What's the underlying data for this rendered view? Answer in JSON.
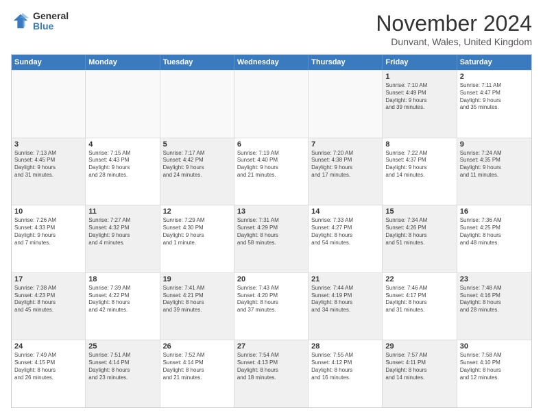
{
  "logo": {
    "general": "General",
    "blue": "Blue"
  },
  "title": "November 2024",
  "location": "Dunvant, Wales, United Kingdom",
  "headers": [
    "Sunday",
    "Monday",
    "Tuesday",
    "Wednesday",
    "Thursday",
    "Friday",
    "Saturday"
  ],
  "rows": [
    [
      {
        "day": "",
        "text": "",
        "empty": true
      },
      {
        "day": "",
        "text": "",
        "empty": true
      },
      {
        "day": "",
        "text": "",
        "empty": true
      },
      {
        "day": "",
        "text": "",
        "empty": true
      },
      {
        "day": "",
        "text": "",
        "empty": true
      },
      {
        "day": "1",
        "text": "Sunrise: 7:10 AM\nSunset: 4:49 PM\nDaylight: 9 hours\nand 39 minutes.",
        "shaded": true
      },
      {
        "day": "2",
        "text": "Sunrise: 7:11 AM\nSunset: 4:47 PM\nDaylight: 9 hours\nand 35 minutes.",
        "shaded": false
      }
    ],
    [
      {
        "day": "3",
        "text": "Sunrise: 7:13 AM\nSunset: 4:45 PM\nDaylight: 9 hours\nand 31 minutes.",
        "shaded": true
      },
      {
        "day": "4",
        "text": "Sunrise: 7:15 AM\nSunset: 4:43 PM\nDaylight: 9 hours\nand 28 minutes.",
        "shaded": false
      },
      {
        "day": "5",
        "text": "Sunrise: 7:17 AM\nSunset: 4:42 PM\nDaylight: 9 hours\nand 24 minutes.",
        "shaded": true
      },
      {
        "day": "6",
        "text": "Sunrise: 7:19 AM\nSunset: 4:40 PM\nDaylight: 9 hours\nand 21 minutes.",
        "shaded": false
      },
      {
        "day": "7",
        "text": "Sunrise: 7:20 AM\nSunset: 4:38 PM\nDaylight: 9 hours\nand 17 minutes.",
        "shaded": true
      },
      {
        "day": "8",
        "text": "Sunrise: 7:22 AM\nSunset: 4:37 PM\nDaylight: 9 hours\nand 14 minutes.",
        "shaded": false
      },
      {
        "day": "9",
        "text": "Sunrise: 7:24 AM\nSunset: 4:35 PM\nDaylight: 9 hours\nand 11 minutes.",
        "shaded": true
      }
    ],
    [
      {
        "day": "10",
        "text": "Sunrise: 7:26 AM\nSunset: 4:33 PM\nDaylight: 9 hours\nand 7 minutes.",
        "shaded": false
      },
      {
        "day": "11",
        "text": "Sunrise: 7:27 AM\nSunset: 4:32 PM\nDaylight: 9 hours\nand 4 minutes.",
        "shaded": true
      },
      {
        "day": "12",
        "text": "Sunrise: 7:29 AM\nSunset: 4:30 PM\nDaylight: 9 hours\nand 1 minute.",
        "shaded": false
      },
      {
        "day": "13",
        "text": "Sunrise: 7:31 AM\nSunset: 4:29 PM\nDaylight: 8 hours\nand 58 minutes.",
        "shaded": true
      },
      {
        "day": "14",
        "text": "Sunrise: 7:33 AM\nSunset: 4:27 PM\nDaylight: 8 hours\nand 54 minutes.",
        "shaded": false
      },
      {
        "day": "15",
        "text": "Sunrise: 7:34 AM\nSunset: 4:26 PM\nDaylight: 8 hours\nand 51 minutes.",
        "shaded": true
      },
      {
        "day": "16",
        "text": "Sunrise: 7:36 AM\nSunset: 4:25 PM\nDaylight: 8 hours\nand 48 minutes.",
        "shaded": false
      }
    ],
    [
      {
        "day": "17",
        "text": "Sunrise: 7:38 AM\nSunset: 4:23 PM\nDaylight: 8 hours\nand 45 minutes.",
        "shaded": true
      },
      {
        "day": "18",
        "text": "Sunrise: 7:39 AM\nSunset: 4:22 PM\nDaylight: 8 hours\nand 42 minutes.",
        "shaded": false
      },
      {
        "day": "19",
        "text": "Sunrise: 7:41 AM\nSunset: 4:21 PM\nDaylight: 8 hours\nand 39 minutes.",
        "shaded": true
      },
      {
        "day": "20",
        "text": "Sunrise: 7:43 AM\nSunset: 4:20 PM\nDaylight: 8 hours\nand 37 minutes.",
        "shaded": false
      },
      {
        "day": "21",
        "text": "Sunrise: 7:44 AM\nSunset: 4:19 PM\nDaylight: 8 hours\nand 34 minutes.",
        "shaded": true
      },
      {
        "day": "22",
        "text": "Sunrise: 7:46 AM\nSunset: 4:17 PM\nDaylight: 8 hours\nand 31 minutes.",
        "shaded": false
      },
      {
        "day": "23",
        "text": "Sunrise: 7:48 AM\nSunset: 4:16 PM\nDaylight: 8 hours\nand 28 minutes.",
        "shaded": true
      }
    ],
    [
      {
        "day": "24",
        "text": "Sunrise: 7:49 AM\nSunset: 4:15 PM\nDaylight: 8 hours\nand 26 minutes.",
        "shaded": false
      },
      {
        "day": "25",
        "text": "Sunrise: 7:51 AM\nSunset: 4:14 PM\nDaylight: 8 hours\nand 23 minutes.",
        "shaded": true
      },
      {
        "day": "26",
        "text": "Sunrise: 7:52 AM\nSunset: 4:14 PM\nDaylight: 8 hours\nand 21 minutes.",
        "shaded": false
      },
      {
        "day": "27",
        "text": "Sunrise: 7:54 AM\nSunset: 4:13 PM\nDaylight: 8 hours\nand 18 minutes.",
        "shaded": true
      },
      {
        "day": "28",
        "text": "Sunrise: 7:55 AM\nSunset: 4:12 PM\nDaylight: 8 hours\nand 16 minutes.",
        "shaded": false
      },
      {
        "day": "29",
        "text": "Sunrise: 7:57 AM\nSunset: 4:11 PM\nDaylight: 8 hours\nand 14 minutes.",
        "shaded": true
      },
      {
        "day": "30",
        "text": "Sunrise: 7:58 AM\nSunset: 4:10 PM\nDaylight: 8 hours\nand 12 minutes.",
        "shaded": false
      }
    ]
  ]
}
